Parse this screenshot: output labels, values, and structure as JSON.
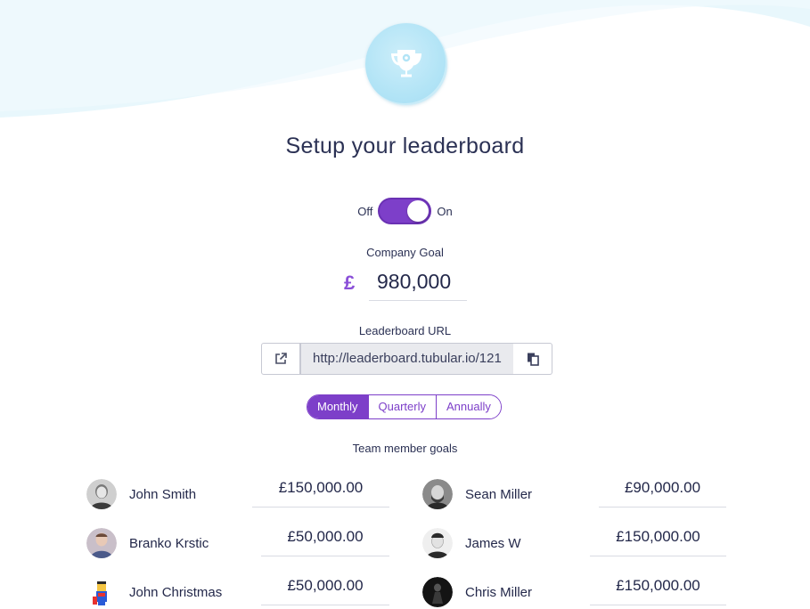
{
  "header": {
    "icon": "trophy-icon",
    "title": "Setup your leaderboard"
  },
  "toggle": {
    "off_label": "Off",
    "on_label": "On",
    "state": "on"
  },
  "company_goal": {
    "label": "Company Goal",
    "currency_symbol": "£",
    "value": "980,000"
  },
  "leaderboard_url": {
    "label": "Leaderboard URL",
    "value": "http://leaderboard.tubular.io/121",
    "open_icon": "external-link-icon",
    "copy_icon": "copy-icon"
  },
  "period_tabs": {
    "options": [
      "Monthly",
      "Quarterly",
      "Annually"
    ],
    "selected": "Monthly"
  },
  "team": {
    "label": "Team member goals",
    "members": [
      {
        "name": "John Smith",
        "goal": "£150,000.00"
      },
      {
        "name": "Sean Miller",
        "goal": "£90,000.00"
      },
      {
        "name": "Branko Krstic",
        "goal": "£50,000.00"
      },
      {
        "name": "James W",
        "goal": "£150,000.00"
      },
      {
        "name": "John Christmas",
        "goal": "£50,000.00"
      },
      {
        "name": "Chris Miller",
        "goal": "£150,000.00"
      }
    ]
  },
  "colors": {
    "accent": "#7d3fc9",
    "wave": "#e6f6fc",
    "trophy_bg": "#b2e4f6",
    "text": "#23284a"
  }
}
